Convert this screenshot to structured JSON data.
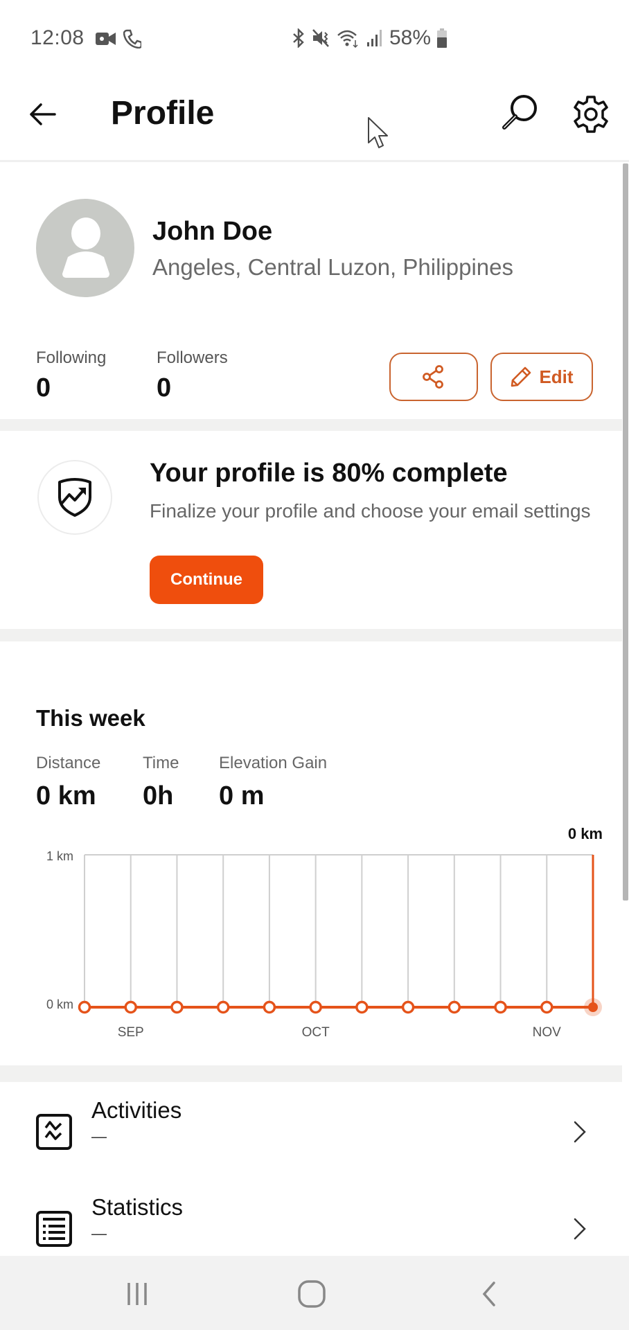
{
  "status_bar": {
    "time": "12:08",
    "battery_percent": "58%",
    "icons_left": [
      "video-call-icon",
      "phone-call-icon"
    ],
    "icons_right": [
      "bluetooth-icon",
      "mute-vibrate-icon",
      "wifi-icon",
      "signal-icon",
      "battery-icon"
    ]
  },
  "header": {
    "title": "Profile",
    "back_icon": "arrow-left-icon",
    "search_icon": "search-icon",
    "settings_icon": "gear-icon"
  },
  "profile": {
    "name": "John Doe",
    "location": "Angeles, Central Luzon, Philippines",
    "following_label": "Following",
    "following_count": "0",
    "followers_label": "Followers",
    "followers_count": "0",
    "share_icon": "share-icon",
    "edit_label": "Edit"
  },
  "completion": {
    "title": "Your profile is 80% complete",
    "percent_complete": 80,
    "subtitle": "Finalize your profile and choose your email settings",
    "button_label": "Continue"
  },
  "this_week": {
    "title": "This week",
    "stats": [
      {
        "label": "Distance",
        "value": "0 km"
      },
      {
        "label": "Time",
        "value": "0h"
      },
      {
        "label": "Elevation Gain",
        "value": "0 m"
      }
    ]
  },
  "chart_data": {
    "type": "line",
    "title": "",
    "current_value_label": "0 km",
    "xlabel": "",
    "ylabel": "",
    "y_tick_labels": [
      "0 km",
      "1 km"
    ],
    "ylim": [
      0,
      1
    ],
    "x_month_labels": [
      {
        "label": "SEP",
        "index": 1
      },
      {
        "label": "OCT",
        "index": 5
      },
      {
        "label": "NOV",
        "index": 10
      }
    ],
    "series": [
      {
        "name": "Weekly distance (km)",
        "values": [
          0,
          0,
          0,
          0,
          0,
          0,
          0,
          0,
          0,
          0,
          0,
          0
        ]
      }
    ],
    "highlighted_index": 11,
    "grid": true,
    "color": "#e5531a"
  },
  "list": [
    {
      "label": "Activities",
      "sub": "—",
      "icon": "activity-icon"
    },
    {
      "label": "Statistics",
      "sub": "—",
      "icon": "statistics-icon"
    }
  ],
  "nav": {
    "recents_icon": "recents-icon",
    "home_icon": "home-icon",
    "back_icon": "back-icon"
  }
}
